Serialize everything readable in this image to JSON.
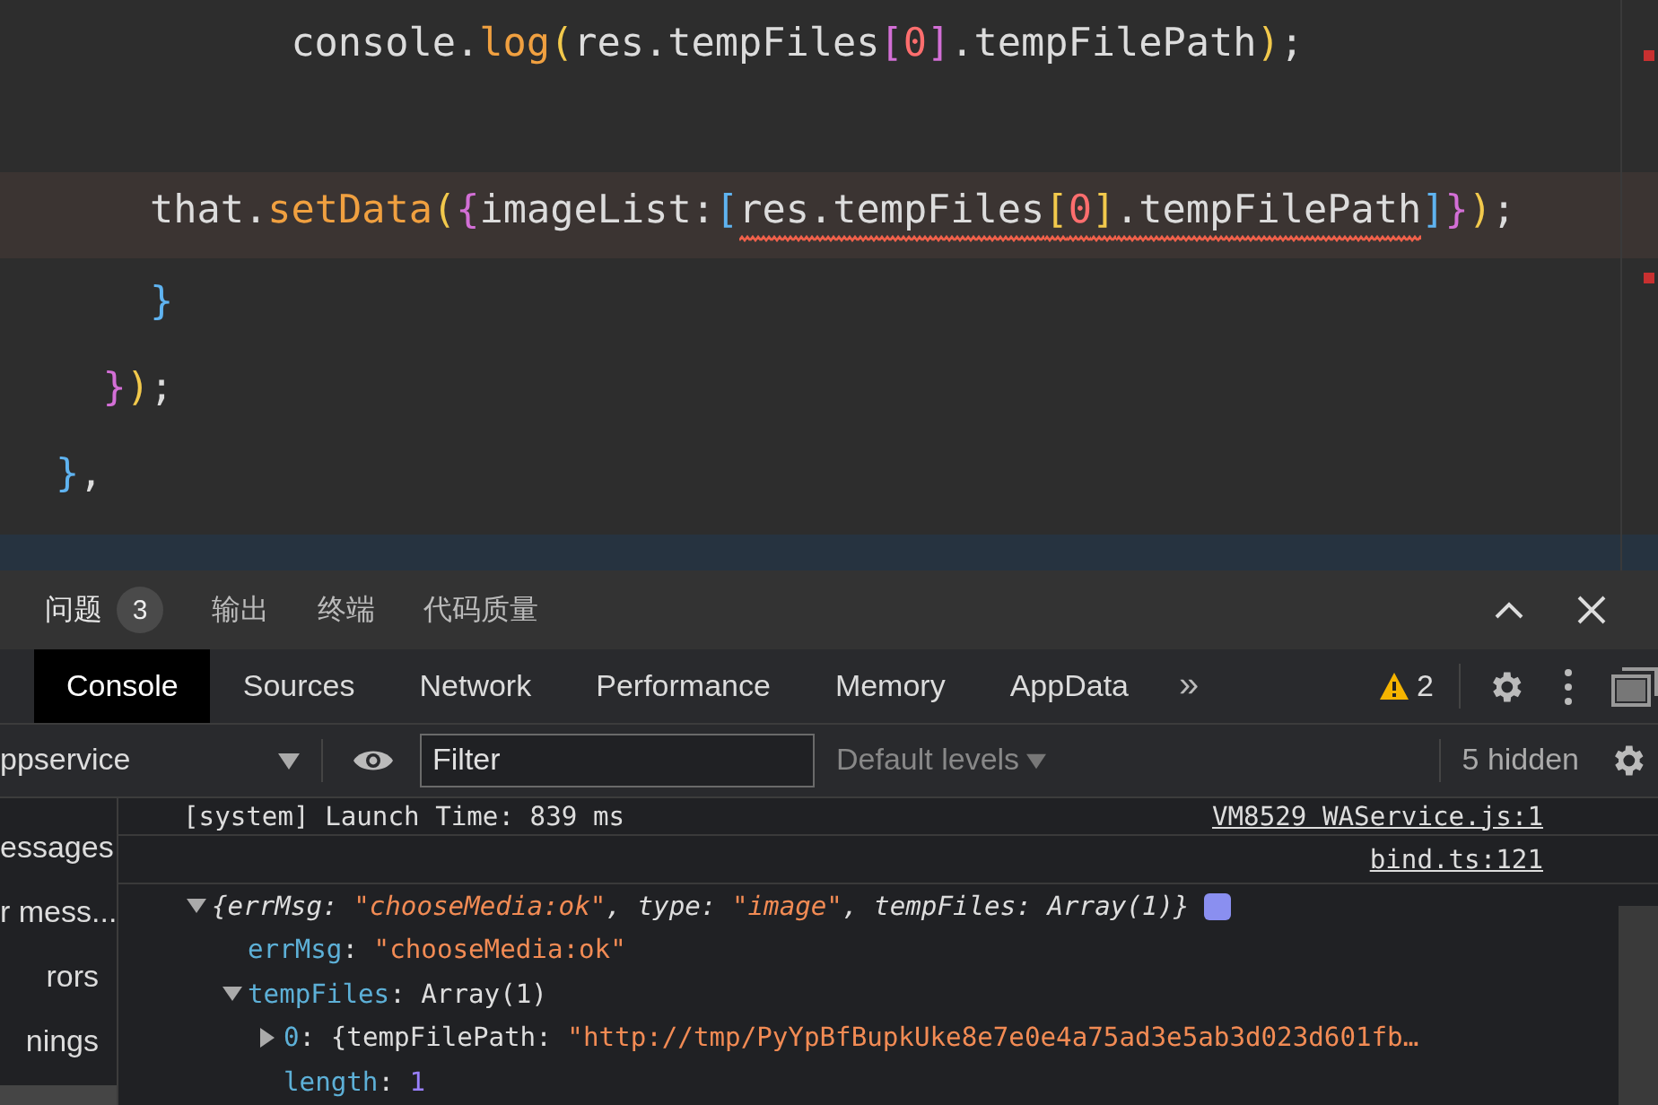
{
  "editor": {
    "lines": [
      {
        "highlighted": false,
        "tokens": [
          {
            "kind": "text",
            "text": "console."
          },
          {
            "kind": "fn",
            "text": "log"
          },
          {
            "kind": "paren",
            "text": "("
          },
          {
            "kind": "text",
            "text": "res.tempFiles"
          },
          {
            "kind": "brace",
            "text": "["
          },
          {
            "kind": "num",
            "text": "0"
          },
          {
            "kind": "brace",
            "text": "]"
          },
          {
            "kind": "text",
            "text": ".tempFilePath"
          },
          {
            "kind": "paren",
            "text": ")"
          },
          {
            "kind": "text",
            "text": ";"
          }
        ]
      },
      {
        "highlighted": false
      },
      {
        "highlighted": true,
        "tokens": [
          {
            "kind": "text",
            "text": "that."
          },
          {
            "kind": "fn",
            "text": "setData"
          },
          {
            "kind": "paren",
            "text": "("
          },
          {
            "kind": "brace",
            "text": "{"
          },
          {
            "kind": "text",
            "text": "imageList:"
          },
          {
            "kind": "bracket",
            "text": "["
          },
          {
            "kind": "text",
            "text": "res.tempFiles",
            "error": true
          },
          {
            "kind": "paren",
            "text": "[",
            "error": true
          },
          {
            "kind": "num",
            "text": "0",
            "error": true
          },
          {
            "kind": "paren",
            "text": "]",
            "error": true
          },
          {
            "kind": "text",
            "text": ".tempFilePath",
            "error": true
          },
          {
            "kind": "bracket",
            "text": "]"
          },
          {
            "kind": "brace",
            "text": "}"
          },
          {
            "kind": "paren",
            "text": ")"
          },
          {
            "kind": "text",
            "text": ";"
          }
        ]
      },
      {
        "highlighted": false,
        "tokens": [
          {
            "kind": "bracket",
            "text": "}"
          }
        ]
      },
      {
        "highlighted": false,
        "tokens": [
          {
            "kind": "brace",
            "text": "}"
          },
          {
            "kind": "paren",
            "text": ")"
          },
          {
            "kind": "text",
            "text": ";"
          }
        ]
      },
      {
        "highlighted": false,
        "tokens": [
          {
            "kind": "bracket",
            "text": "}"
          },
          {
            "kind": "text",
            "text": ","
          }
        ]
      }
    ]
  },
  "panel_tabs": [
    {
      "label": "问题",
      "badge": "3",
      "selected": true
    },
    {
      "label": "输出",
      "selected": false
    },
    {
      "label": "终端",
      "selected": false
    },
    {
      "label": "代码质量",
      "selected": false
    }
  ],
  "devtools_tabs": [
    {
      "label": "Console",
      "selected": true
    },
    {
      "label": "Sources",
      "selected": false
    },
    {
      "label": "Network",
      "selected": false
    },
    {
      "label": "Performance",
      "selected": false
    },
    {
      "label": "Memory",
      "selected": false
    },
    {
      "label": "AppData",
      "selected": false
    }
  ],
  "more_tabs": "»",
  "warnings": "2",
  "toolbar": {
    "context": "ppservice",
    "filter": {
      "placeholder": "Filter"
    },
    "levels": "Default levels",
    "hidden": "5 hidden"
  },
  "sidebar": [
    {
      "label": "essages",
      "selected": false
    },
    {
      "label": "r mess...",
      "selected": false
    },
    {
      "label": "rors",
      "selected": false
    },
    {
      "label": "nings",
      "selected": false
    }
  ],
  "console": [
    {
      "kind": "log",
      "text": "[system] Launch Time: 839 ms",
      "source": "VM8529 WAService.js:1"
    },
    {
      "kind": "source",
      "source": "bind.ts:121"
    },
    {
      "kind": "preview",
      "expanded": true,
      "info": true,
      "tokens": [
        {
          "kind": "plain",
          "text": "{errMsg: "
        },
        {
          "kind": "str",
          "text": "\"chooseMedia:ok\""
        },
        {
          "kind": "plain",
          "text": ", type: "
        },
        {
          "kind": "str",
          "text": "\"image\""
        },
        {
          "kind": "plain",
          "text": ", tempFiles: Array(1)}"
        }
      ],
      "children": [
        {
          "tokens": [
            {
              "kind": "key",
              "text": "errMsg"
            },
            {
              "kind": "plain",
              "text": ": "
            },
            {
              "kind": "str",
              "text": "\"chooseMedia:ok\""
            }
          ]
        },
        {
          "expanded": true,
          "tokens": [
            {
              "kind": "key",
              "text": "tempFiles"
            },
            {
              "kind": "plain",
              "text": ": Array(1)"
            }
          ],
          "children": [
            {
              "expanded": false,
              "tokens": [
                {
                  "kind": "key",
                  "text": "0"
                },
                {
                  "kind": "plain",
                  "text": ": {tempFilePath: "
                },
                {
                  "kind": "str",
                  "text": "\"http://tmp/PyYpBfBupkUke8e7e0e4a75ad3e5ab3d023d601fb…"
                }
              ]
            },
            {
              "tokens": [
                {
                  "kind": "key",
                  "text": "length"
                },
                {
                  "kind": "plain",
                  "text": ": "
                },
                {
                  "kind": "num",
                  "text": "1"
                }
              ]
            }
          ]
        }
      ]
    }
  ]
}
